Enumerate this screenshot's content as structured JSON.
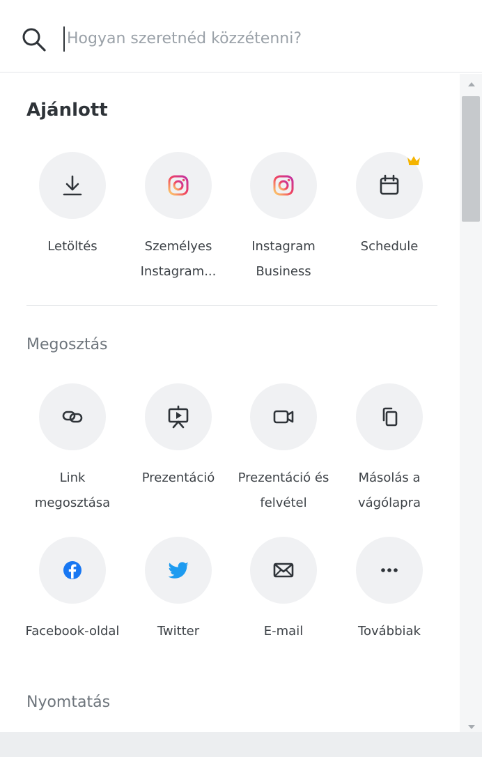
{
  "search": {
    "placeholder": "Hogyan szeretnéd közzétenni?",
    "value": ""
  },
  "sections": {
    "recommended": {
      "title": "Ajánlott",
      "items": [
        {
          "label": "Letöltés",
          "icon": "download-icon"
        },
        {
          "label": "Személyes Instagram...",
          "icon": "instagram-icon"
        },
        {
          "label": "Instagram Business",
          "icon": "instagram-icon"
        },
        {
          "label": "Schedule",
          "icon": "calendar-icon",
          "badge": "crown-icon"
        }
      ]
    },
    "share": {
      "title": "Megosztás",
      "items": [
        {
          "label": "Link megosztása",
          "icon": "link-icon"
        },
        {
          "label": "Prezentáció",
          "icon": "presentation-icon"
        },
        {
          "label": "Prezentáció és felvétel",
          "icon": "video-camera-icon"
        },
        {
          "label": "Másolás a vágólapra",
          "icon": "copy-icon"
        },
        {
          "label": "Facebook-oldal",
          "icon": "facebook-icon"
        },
        {
          "label": "Twitter",
          "icon": "twitter-icon"
        },
        {
          "label": "E-mail",
          "icon": "mail-icon"
        },
        {
          "label": "Továbbiak",
          "icon": "more-icon"
        }
      ]
    },
    "print": {
      "title": "Nyomtatás"
    }
  },
  "colors": {
    "instagram_gradient": [
      "#fdd36b",
      "#f0435f",
      "#c02ea4"
    ],
    "facebook": "#1877f2",
    "twitter": "#1d9bf0",
    "crown": "#f5b400",
    "circle_bg": "#f0f1f3"
  }
}
